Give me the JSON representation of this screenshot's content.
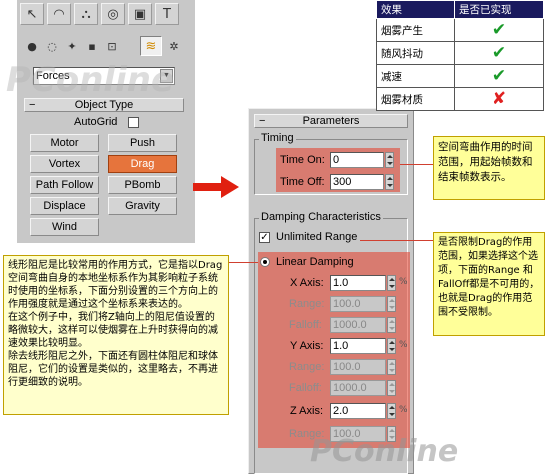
{
  "left_panel": {
    "category_dropdown": "Forces",
    "object_type_title": "Object Type",
    "autogrid_label": "AutoGrid",
    "buttons": [
      "Motor",
      "Push",
      "Vortex",
      "Drag",
      "Path Follow",
      "PBomb",
      "Displace",
      "Gravity",
      "Wind"
    ],
    "active_button": "Drag"
  },
  "parameters": {
    "title": "Parameters",
    "timing": {
      "group": "Timing",
      "time_on_label": "Time On:",
      "time_on": "0",
      "time_off_label": "Time Off:",
      "time_off": "300"
    },
    "damping": {
      "group": "Damping Characteristics",
      "unlimited_label": "Unlimited Range",
      "linear_label": "Linear Damping",
      "rows": [
        {
          "label": "X Axis:",
          "value": "1.0"
        },
        {
          "label": "Range:",
          "value": "100.0"
        },
        {
          "label": "Falloff:",
          "value": "1000.0"
        },
        {
          "label": "Y Axis:",
          "value": "1.0"
        },
        {
          "label": "Range:",
          "value": "100.0"
        },
        {
          "label": "Falloff:",
          "value": "1000.0"
        },
        {
          "label": "Z Axis:",
          "value": "2.0"
        },
        {
          "label": "Range:",
          "value": "100.0"
        }
      ],
      "pct": "%"
    }
  },
  "ref_table": {
    "headers": [
      "效果",
      "是否已实现"
    ],
    "rows": [
      {
        "effect": "烟雾产生",
        "ok": true
      },
      {
        "effect": "随风抖动",
        "ok": true
      },
      {
        "effect": "减速",
        "ok": true
      },
      {
        "effect": "烟雾材质",
        "ok": false
      }
    ]
  },
  "notes": {
    "timing": "空间弯曲作用的时间范围，用起始帧数和结束帧数表示。",
    "range": "是否限制Drag的作用范围，如果选择这个选项，下面的Range 和FallOff都是不可用的，也就是Drag的作用范围不受限制。",
    "main": "线形阻尼是比较常用的作用方式，它是指以Drag空间弯曲自身的本地坐标系作为其影响粒子系统时使用的坐标系，下面分别设置的三个方向上的作用强度就是通过这个坐标系来表达的。\n在这个例子中，我们将Z轴向上的阻尼值设置的略微较大，这样可以使烟雾在上升时获得向的减速效果比较明显。\n除去线形阻尼之外，下面还有圆柱体阻尼和球体阻尼，它们的设置是类似的，这里略去，不再进行更细致的说明。"
  },
  "watermark": "PConline",
  "colors": {
    "highlight": "#e63c28",
    "accent": "#e6743c",
    "check": "#1a9a2a",
    "cross": "#e02020",
    "table_header": "#1a1a5e"
  }
}
